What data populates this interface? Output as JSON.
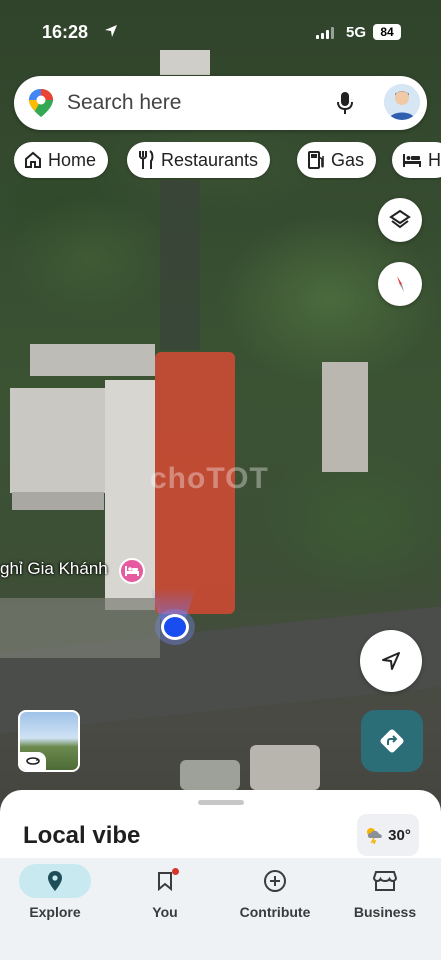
{
  "status_bar": {
    "time": "16:28",
    "network": "5G",
    "battery": "84"
  },
  "search": {
    "placeholder": "Search here"
  },
  "chips": [
    {
      "label": "Home",
      "icon": "home-icon"
    },
    {
      "label": "Restaurants",
      "icon": "restaurant-icon"
    },
    {
      "label": "Gas",
      "icon": "gas-icon"
    },
    {
      "label": "H",
      "icon": "hotel-icon"
    }
  ],
  "map": {
    "place_label": "ghỉ Gia Khánh",
    "place_icon": "bed-icon",
    "watermark": "choTOT",
    "highlight_color": "#d64a34"
  },
  "sheet": {
    "title": "Local vibe",
    "temperature": "30°",
    "weather_icon": "thunderstorm-icon"
  },
  "nav": [
    {
      "label": "Explore",
      "icon": "location-pin-icon",
      "active": true
    },
    {
      "label": "You",
      "icon": "bookmark-icon",
      "active": false
    },
    {
      "label": "Contribute",
      "icon": "add-circle-icon",
      "active": false
    },
    {
      "label": "Business",
      "icon": "storefront-icon",
      "active": false
    }
  ],
  "colors": {
    "accent": "#2b6e78",
    "nav_active": "#c8e9ef"
  }
}
